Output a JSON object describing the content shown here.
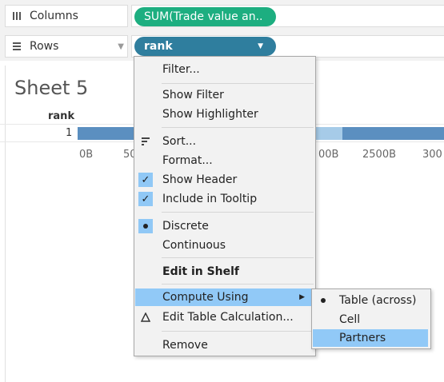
{
  "shelves": {
    "columns": {
      "label": "Columns",
      "icon": "columns-icon",
      "pill": "SUM(Trade value an.."
    },
    "rows": {
      "label": "Rows",
      "icon": "rows-icon",
      "pill": "rank"
    }
  },
  "sheet": {
    "title": "Sheet 5",
    "header": "rank",
    "row_value": "1",
    "ticks": [
      "0B",
      "50",
      "00B",
      "2500B",
      "300"
    ]
  },
  "context_menu": {
    "items": [
      {
        "label": "Filter..."
      },
      {
        "label": "Show Filter"
      },
      {
        "label": "Show Highlighter"
      },
      {
        "label": "Sort...",
        "icon": "sort-icon"
      },
      {
        "label": "Format..."
      },
      {
        "label": "Show Header",
        "checked": true
      },
      {
        "label": "Include in Tooltip",
        "checked": true
      },
      {
        "label": "Discrete",
        "selected": true
      },
      {
        "label": "Continuous"
      },
      {
        "label": "Edit in Shelf",
        "bold": true
      },
      {
        "label": "Compute Using",
        "highlighted": true,
        "submenu": true
      },
      {
        "label": "Edit Table Calculation...",
        "icon": "delta-icon"
      },
      {
        "label": "Remove"
      }
    ]
  },
  "submenu": {
    "items": [
      {
        "label": "Table (across)",
        "selected": true
      },
      {
        "label": "Cell"
      },
      {
        "label": "Partners",
        "highlighted": true
      }
    ]
  },
  "colors": {
    "measure_pill": "#1dae80",
    "dimension_pill": "#2f7e9e",
    "bar": "#5b8fc0",
    "highlight": "#91c9f7"
  }
}
